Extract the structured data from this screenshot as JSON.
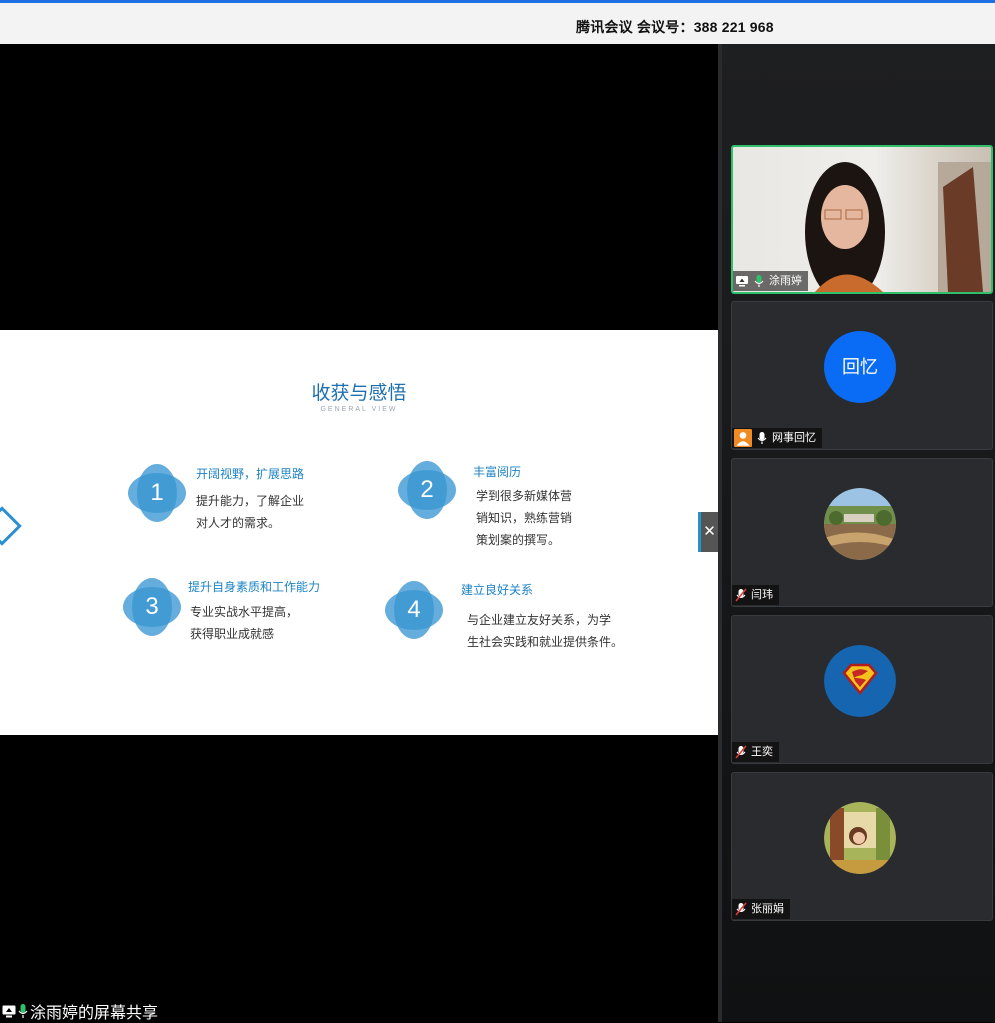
{
  "header": {
    "title": "腾讯会议 会议号：388 221 968"
  },
  "slide": {
    "title": "收获与感悟",
    "subtitle": "GENERAL VIEW",
    "items": [
      {
        "num": "1",
        "title": "开阔视野，扩展思路",
        "desc1": "提升能力，了解企业",
        "desc2": "对人才的需求。",
        "desc3": ""
      },
      {
        "num": "2",
        "title": "丰富阅历",
        "desc1": "学到很多新媒体营",
        "desc2": "销知识，熟练营销",
        "desc3": "策划案的撰写。"
      },
      {
        "num": "3",
        "title": "提升自身素质和工作能力",
        "desc1": "专业实战水平提高，",
        "desc2": "获得职业成就感",
        "desc3": ""
      },
      {
        "num": "4",
        "title": "建立良好关系",
        "desc1": "与企业建立友好关系，为学",
        "desc2": "生社会实践和就业提供条件。",
        "desc3": ""
      }
    ]
  },
  "share_label": "涂雨婷的屏幕共享",
  "participants": [
    {
      "name": "涂雨婷",
      "type": "video",
      "mic": "on"
    },
    {
      "name": "网事回忆",
      "type": "avatar-text",
      "avatar_text": "回忆",
      "mic": "on"
    },
    {
      "name": "闫玮",
      "type": "avatar-photo",
      "icon": "landscape-avatar-icon",
      "mic": "muted"
    },
    {
      "name": "王奕",
      "type": "avatar-photo",
      "icon": "superman-logo-avatar-icon",
      "mic": "muted"
    },
    {
      "name": "张丽娟",
      "type": "avatar-photo",
      "icon": "cartoon-girl-avatar-icon",
      "mic": "muted"
    }
  ],
  "colors": {
    "accent": "#1d83c4",
    "active_border": "#2fc06b",
    "avatar_blue": "#0a6cf5",
    "mic_on": "#2fc06b"
  }
}
